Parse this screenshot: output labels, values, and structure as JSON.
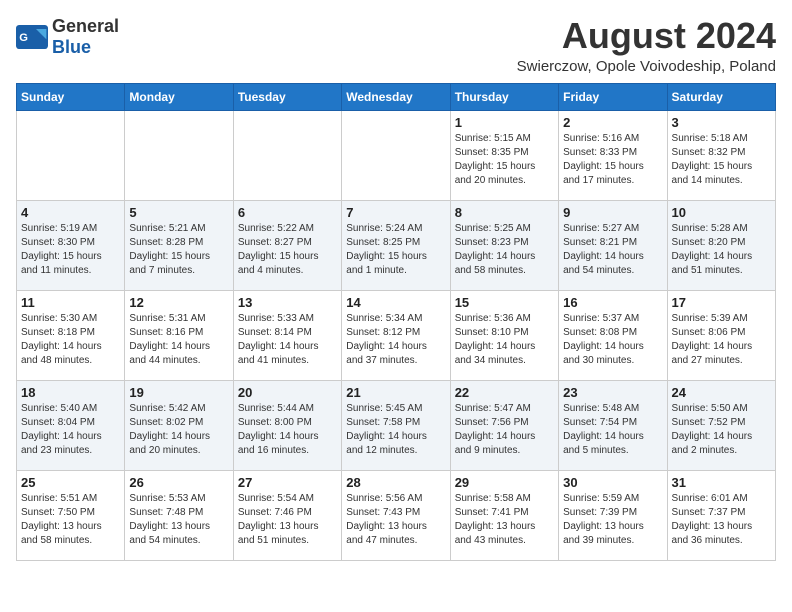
{
  "header": {
    "logo_general": "General",
    "logo_blue": "Blue",
    "main_title": "August 2024",
    "subtitle": "Swierczow, Opole Voivodeship, Poland"
  },
  "calendar": {
    "days_of_week": [
      "Sunday",
      "Monday",
      "Tuesday",
      "Wednesday",
      "Thursday",
      "Friday",
      "Saturday"
    ],
    "weeks": [
      [
        {
          "day": "",
          "info": ""
        },
        {
          "day": "",
          "info": ""
        },
        {
          "day": "",
          "info": ""
        },
        {
          "day": "",
          "info": ""
        },
        {
          "day": "1",
          "info": "Sunrise: 5:15 AM\nSunset: 8:35 PM\nDaylight: 15 hours\nand 20 minutes."
        },
        {
          "day": "2",
          "info": "Sunrise: 5:16 AM\nSunset: 8:33 PM\nDaylight: 15 hours\nand 17 minutes."
        },
        {
          "day": "3",
          "info": "Sunrise: 5:18 AM\nSunset: 8:32 PM\nDaylight: 15 hours\nand 14 minutes."
        }
      ],
      [
        {
          "day": "4",
          "info": "Sunrise: 5:19 AM\nSunset: 8:30 PM\nDaylight: 15 hours\nand 11 minutes."
        },
        {
          "day": "5",
          "info": "Sunrise: 5:21 AM\nSunset: 8:28 PM\nDaylight: 15 hours\nand 7 minutes."
        },
        {
          "day": "6",
          "info": "Sunrise: 5:22 AM\nSunset: 8:27 PM\nDaylight: 15 hours\nand 4 minutes."
        },
        {
          "day": "7",
          "info": "Sunrise: 5:24 AM\nSunset: 8:25 PM\nDaylight: 15 hours\nand 1 minute."
        },
        {
          "day": "8",
          "info": "Sunrise: 5:25 AM\nSunset: 8:23 PM\nDaylight: 14 hours\nand 58 minutes."
        },
        {
          "day": "9",
          "info": "Sunrise: 5:27 AM\nSunset: 8:21 PM\nDaylight: 14 hours\nand 54 minutes."
        },
        {
          "day": "10",
          "info": "Sunrise: 5:28 AM\nSunset: 8:20 PM\nDaylight: 14 hours\nand 51 minutes."
        }
      ],
      [
        {
          "day": "11",
          "info": "Sunrise: 5:30 AM\nSunset: 8:18 PM\nDaylight: 14 hours\nand 48 minutes."
        },
        {
          "day": "12",
          "info": "Sunrise: 5:31 AM\nSunset: 8:16 PM\nDaylight: 14 hours\nand 44 minutes."
        },
        {
          "day": "13",
          "info": "Sunrise: 5:33 AM\nSunset: 8:14 PM\nDaylight: 14 hours\nand 41 minutes."
        },
        {
          "day": "14",
          "info": "Sunrise: 5:34 AM\nSunset: 8:12 PM\nDaylight: 14 hours\nand 37 minutes."
        },
        {
          "day": "15",
          "info": "Sunrise: 5:36 AM\nSunset: 8:10 PM\nDaylight: 14 hours\nand 34 minutes."
        },
        {
          "day": "16",
          "info": "Sunrise: 5:37 AM\nSunset: 8:08 PM\nDaylight: 14 hours\nand 30 minutes."
        },
        {
          "day": "17",
          "info": "Sunrise: 5:39 AM\nSunset: 8:06 PM\nDaylight: 14 hours\nand 27 minutes."
        }
      ],
      [
        {
          "day": "18",
          "info": "Sunrise: 5:40 AM\nSunset: 8:04 PM\nDaylight: 14 hours\nand 23 minutes."
        },
        {
          "day": "19",
          "info": "Sunrise: 5:42 AM\nSunset: 8:02 PM\nDaylight: 14 hours\nand 20 minutes."
        },
        {
          "day": "20",
          "info": "Sunrise: 5:44 AM\nSunset: 8:00 PM\nDaylight: 14 hours\nand 16 minutes."
        },
        {
          "day": "21",
          "info": "Sunrise: 5:45 AM\nSunset: 7:58 PM\nDaylight: 14 hours\nand 12 minutes."
        },
        {
          "day": "22",
          "info": "Sunrise: 5:47 AM\nSunset: 7:56 PM\nDaylight: 14 hours\nand 9 minutes."
        },
        {
          "day": "23",
          "info": "Sunrise: 5:48 AM\nSunset: 7:54 PM\nDaylight: 14 hours\nand 5 minutes."
        },
        {
          "day": "24",
          "info": "Sunrise: 5:50 AM\nSunset: 7:52 PM\nDaylight: 14 hours\nand 2 minutes."
        }
      ],
      [
        {
          "day": "25",
          "info": "Sunrise: 5:51 AM\nSunset: 7:50 PM\nDaylight: 13 hours\nand 58 minutes."
        },
        {
          "day": "26",
          "info": "Sunrise: 5:53 AM\nSunset: 7:48 PM\nDaylight: 13 hours\nand 54 minutes."
        },
        {
          "day": "27",
          "info": "Sunrise: 5:54 AM\nSunset: 7:46 PM\nDaylight: 13 hours\nand 51 minutes."
        },
        {
          "day": "28",
          "info": "Sunrise: 5:56 AM\nSunset: 7:43 PM\nDaylight: 13 hours\nand 47 minutes."
        },
        {
          "day": "29",
          "info": "Sunrise: 5:58 AM\nSunset: 7:41 PM\nDaylight: 13 hours\nand 43 minutes."
        },
        {
          "day": "30",
          "info": "Sunrise: 5:59 AM\nSunset: 7:39 PM\nDaylight: 13 hours\nand 39 minutes."
        },
        {
          "day": "31",
          "info": "Sunrise: 6:01 AM\nSunset: 7:37 PM\nDaylight: 13 hours\nand 36 minutes."
        }
      ]
    ]
  }
}
